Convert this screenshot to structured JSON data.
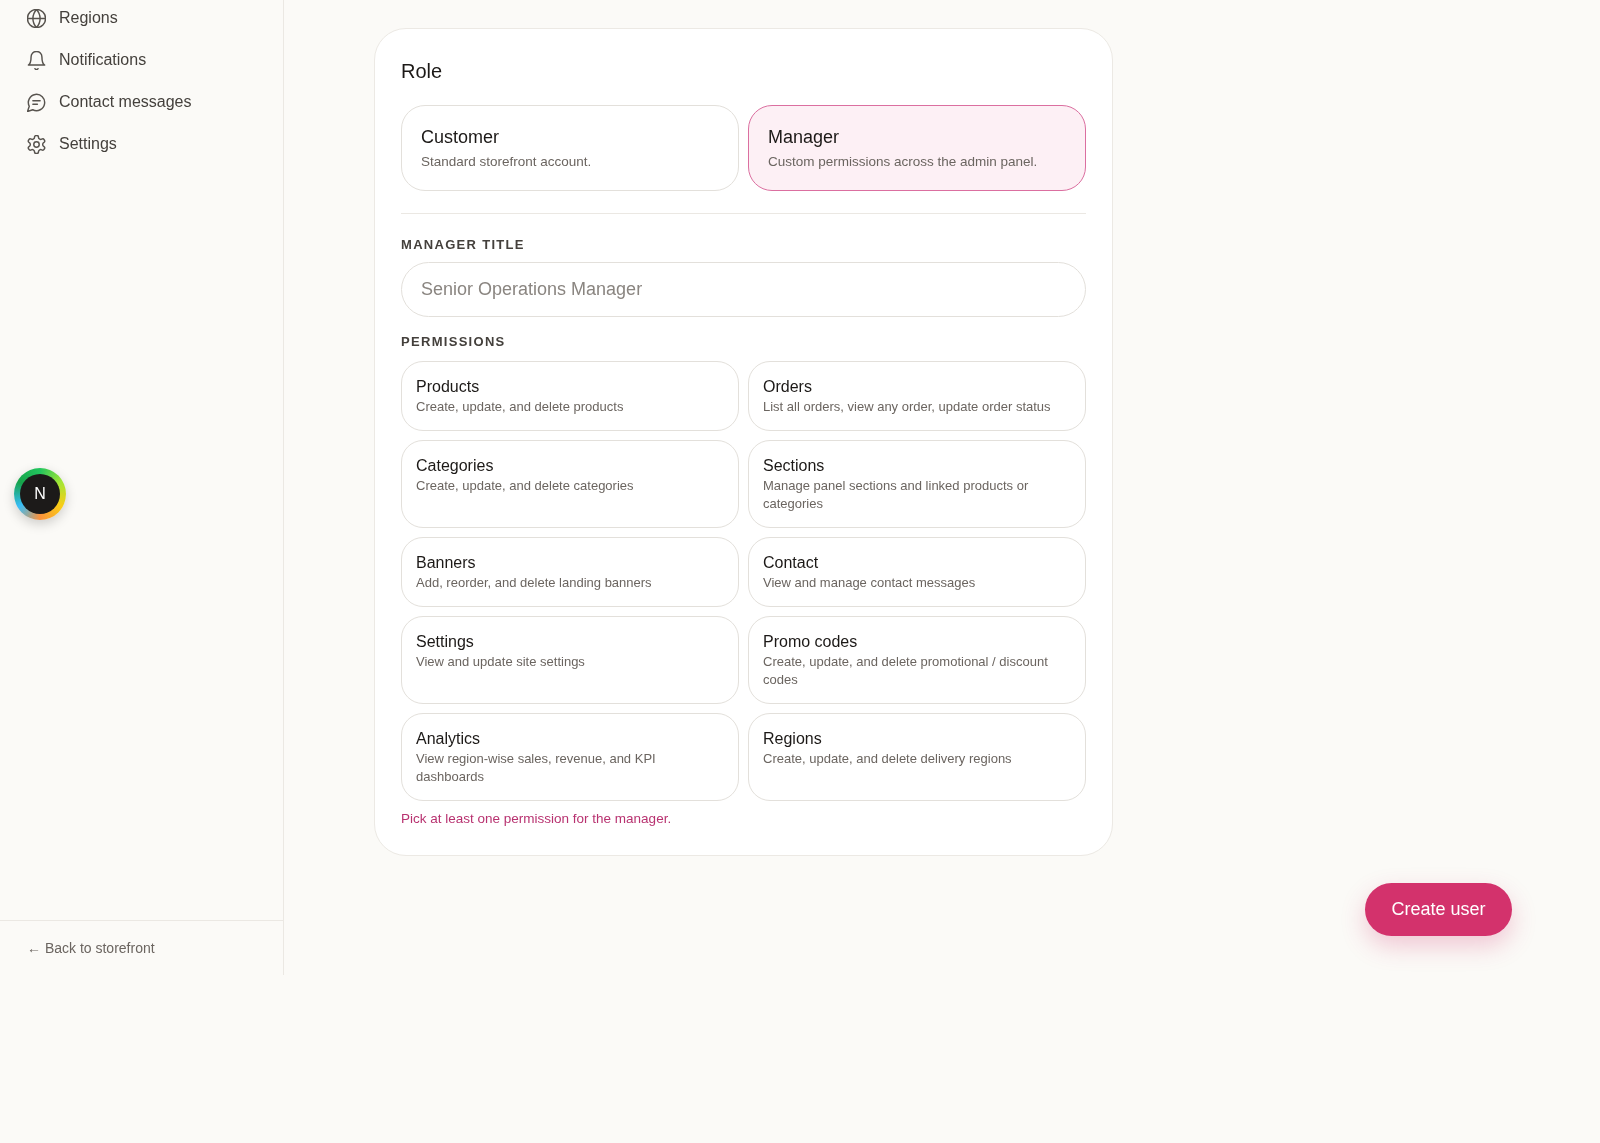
{
  "sidebar": {
    "nav_items": [
      {
        "label": "Regions"
      },
      {
        "label": "Notifications"
      },
      {
        "label": "Contact messages"
      },
      {
        "label": "Settings"
      }
    ],
    "back_link": "← Back to storefront"
  },
  "avatar": {
    "initial": "N"
  },
  "form": {
    "role": {
      "heading": "Role",
      "options": [
        {
          "title": "Customer",
          "description": "Standard storefront account.",
          "selected": false
        },
        {
          "title": "Manager",
          "description": "Custom permissions across the admin panel.",
          "selected": true
        }
      ]
    },
    "manager_title": {
      "label": "MANAGER TITLE",
      "placeholder": "Senior Operations Manager"
    },
    "permissions": {
      "label": "PERMISSIONS",
      "items": [
        {
          "title": "Products",
          "description": "Create, update, and delete products",
          "selected": false
        },
        {
          "title": "Orders",
          "description": "List all orders, view any order, update order status",
          "selected": false
        },
        {
          "title": "Categories",
          "description": "Create, update, and delete categories",
          "selected": false
        },
        {
          "title": "Sections",
          "description": "Manage panel sections and linked products or categories",
          "selected": false
        },
        {
          "title": "Banners",
          "description": "Add, reorder, and delete landing banners",
          "selected": false
        },
        {
          "title": "Contact",
          "description": "View and manage contact messages",
          "selected": false
        },
        {
          "title": "Settings",
          "description": "View and update site settings",
          "selected": false
        },
        {
          "title": "Promo codes",
          "description": "Create, update, and delete promotional / discount codes",
          "selected": false
        },
        {
          "title": "Analytics",
          "description": "View region-wise sales, revenue, and KPI dashboards",
          "selected": false
        },
        {
          "title": "Regions",
          "description": "Create, update, and delete delivery regions",
          "selected": false
        }
      ],
      "error": "Pick at least one permission for the manager."
    }
  },
  "actions": {
    "submit": "Create user"
  }
}
